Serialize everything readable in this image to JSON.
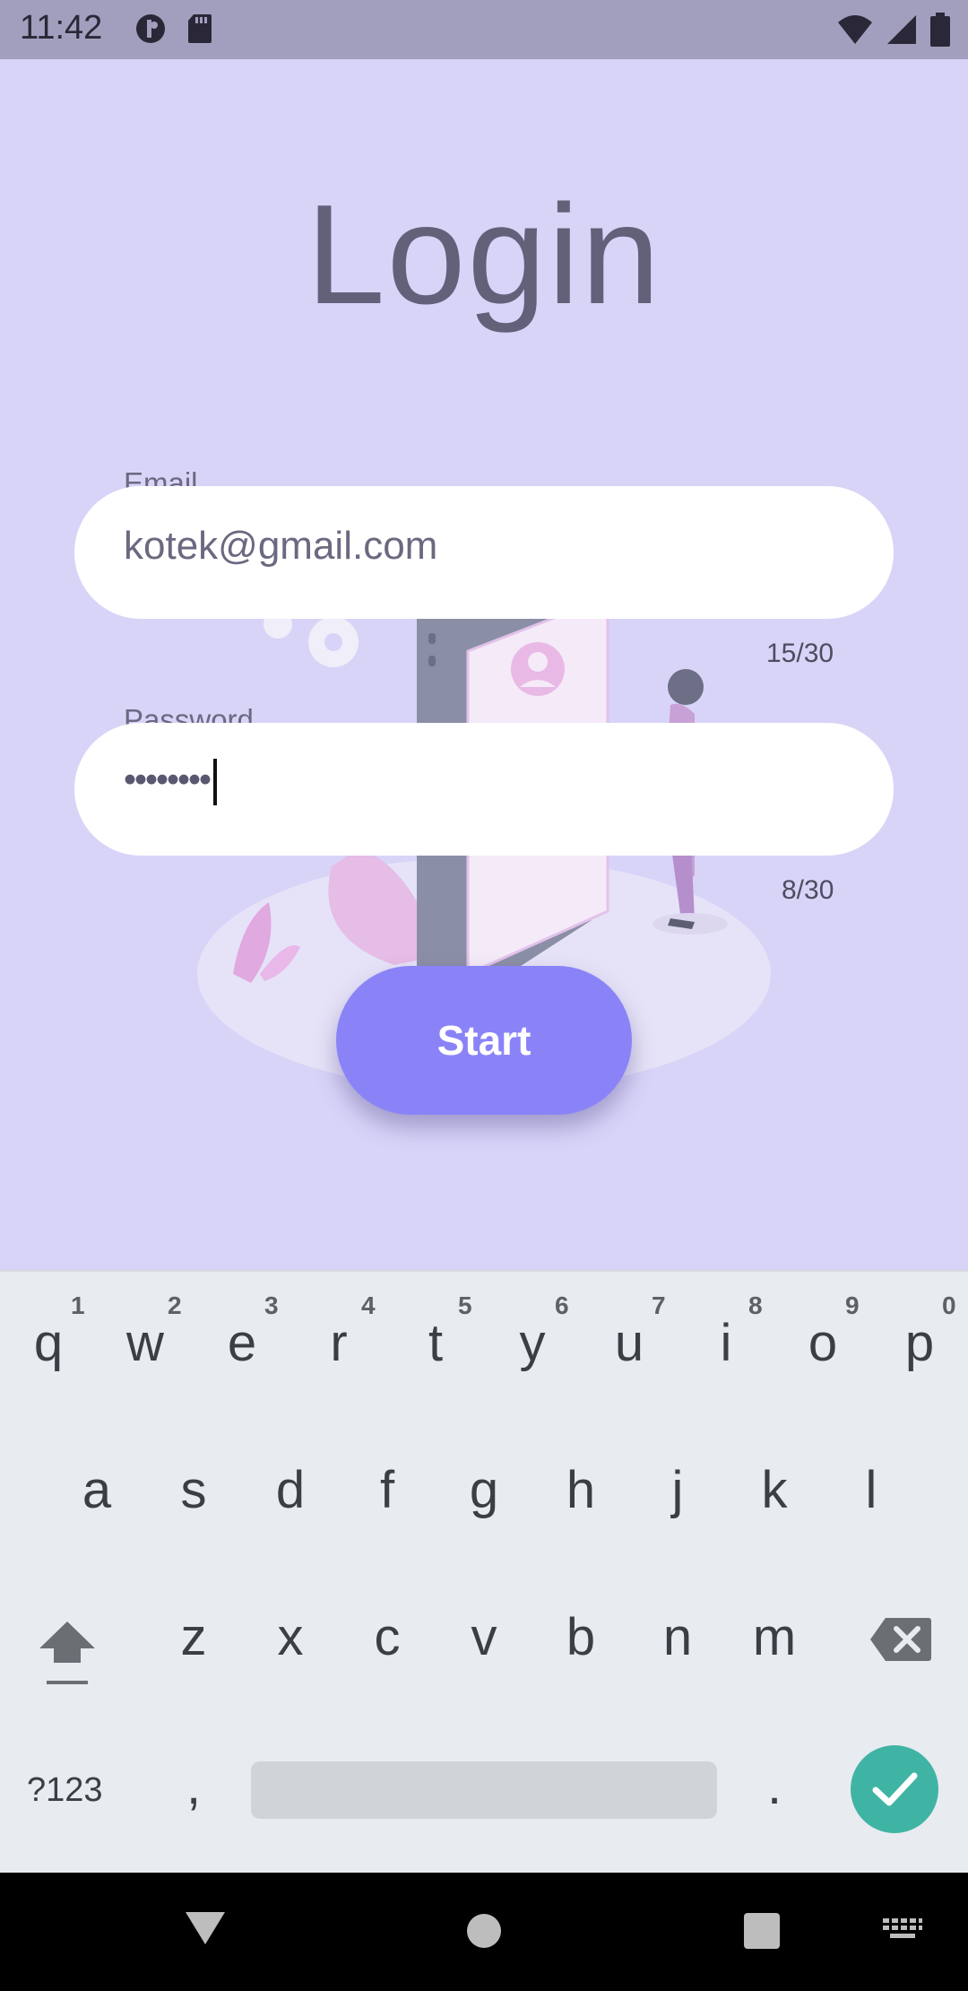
{
  "status_bar": {
    "time": "11:42",
    "left_icons": [
      "data-saver-icon",
      "sd-card-icon"
    ],
    "right_icons": [
      "wifi-icon",
      "cell-signal-icon",
      "battery-icon"
    ]
  },
  "screen": {
    "title": "Login",
    "email": {
      "label": "Email",
      "value": "kotek@gmail.com",
      "counter": "15/30"
    },
    "password": {
      "label": "Password",
      "masked_value": "••••••••",
      "counter": "8/30"
    },
    "start_button": "Start"
  },
  "keyboard": {
    "row1": [
      "q",
      "w",
      "e",
      "r",
      "t",
      "y",
      "u",
      "i",
      "o",
      "p"
    ],
    "row1_hints": [
      "1",
      "2",
      "3",
      "4",
      "5",
      "6",
      "7",
      "8",
      "9",
      "0"
    ],
    "row2": [
      "a",
      "s",
      "d",
      "f",
      "g",
      "h",
      "j",
      "k",
      "l"
    ],
    "row3": [
      "z",
      "x",
      "c",
      "v",
      "b",
      "n",
      "m"
    ],
    "symbols_key": "?123",
    "comma_key": ",",
    "period_key": ".",
    "icons": [
      "shift-icon",
      "backspace-icon",
      "enter-check-icon"
    ]
  },
  "nav_bar": {
    "icons": [
      "back-icon",
      "home-icon",
      "recents-icon",
      "keyboard-switch-icon"
    ]
  },
  "colors": {
    "background": "#d8d4f8",
    "accent": "#8a83f8",
    "title": "#63607a",
    "enter_key": "#3fb4a4"
  }
}
